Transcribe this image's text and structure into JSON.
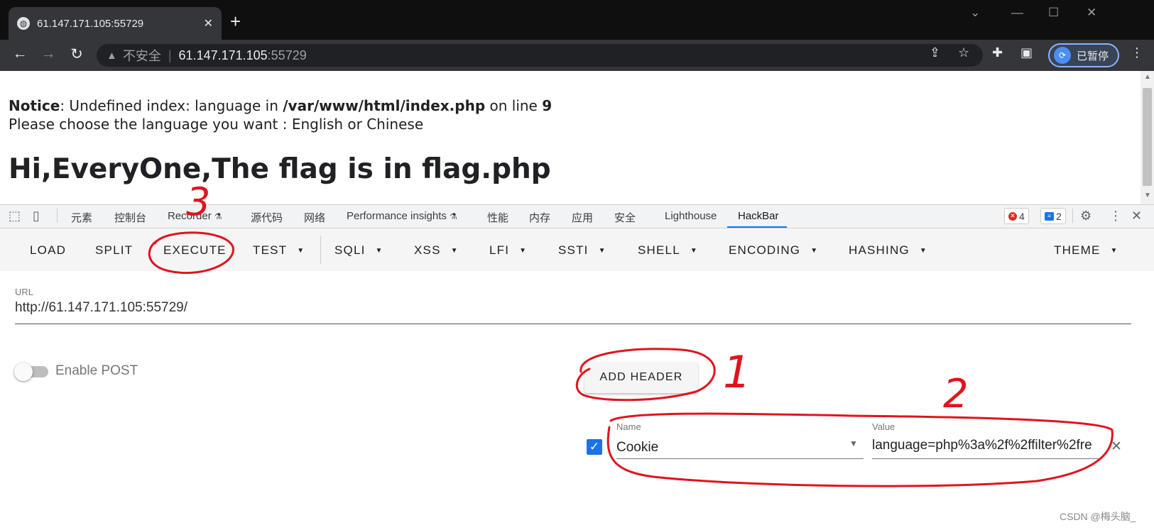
{
  "browser": {
    "tab_title": "61.147.171.105:55729",
    "tab_close": "✕",
    "new_tab": "+",
    "window_minimize": "—",
    "window_maximize": "☐",
    "window_close": "✕",
    "window_dropdown": "⌄"
  },
  "omnibox": {
    "warning_glyph": "▲",
    "insecure_label": "不安全",
    "separator": "|",
    "host": "61.147.171.105",
    "port": ":55729"
  },
  "profile": {
    "label": "已暂停"
  },
  "page": {
    "notice_label": "Notice",
    "notice_text": ": Undefined index: language in ",
    "notice_path": "/var/www/html/index.php",
    "notice_online": " on line ",
    "notice_line": "9",
    "choose_text": "Please choose the language you want : English or Chinese",
    "heading": "Hi,EveryOne,The flag is in flag.php"
  },
  "devtools": {
    "tabs": [
      "元素",
      "控制台",
      "Recorder",
      "源代码",
      "网络",
      "Performance insights",
      "性能",
      "内存",
      "应用",
      "安全",
      "Lighthouse",
      "HackBar"
    ],
    "active_tab": "HackBar",
    "errors_count": "4",
    "messages_count": "2"
  },
  "hackbar": {
    "menu": {
      "load": "LOAD",
      "split": "SPLIT",
      "execute": "EXECUTE",
      "test": "TEST",
      "sqli": "SQLI",
      "xss": "XSS",
      "lfi": "LFI",
      "ssti": "SSTI",
      "shell": "SHELL",
      "encoding": "ENCODING",
      "hashing": "HASHING",
      "theme": "THEME"
    },
    "url_label": "URL",
    "url_value": "http://61.147.171.105:55729/",
    "enable_post_label": "Enable POST",
    "enable_post_on": false,
    "add_header_label": "ADD HEADER",
    "header": {
      "enabled": true,
      "name_label": "Name",
      "name_value": "Cookie",
      "value_label": "Value",
      "value_value": "language=php%3a%2f%2ffilter%2fre"
    }
  },
  "annotations": {
    "one": "1",
    "two": "2",
    "three": "3",
    "color": "#e0141e"
  },
  "watermark": "CSDN @梅头脑_",
  "colors": {
    "accent": "#1a73e8",
    "tabstrip": "#0f0f10",
    "toolbar": "#35363a"
  }
}
